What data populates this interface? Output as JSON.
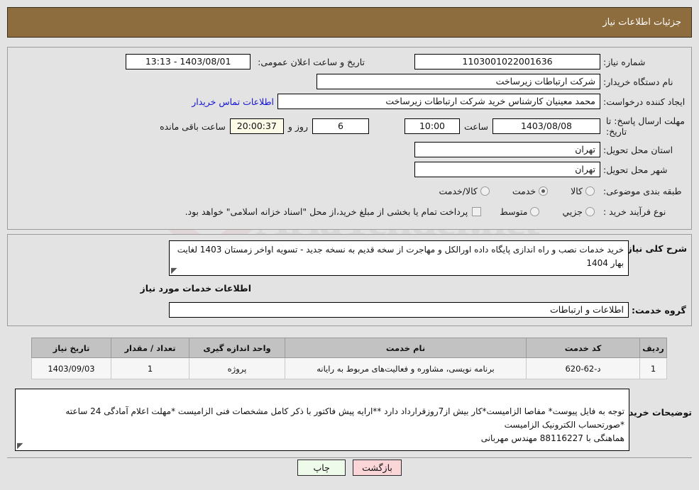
{
  "header": {
    "title": "جزئیات اطلاعات نیاز"
  },
  "watermark": {
    "text": "AriaTender.net"
  },
  "form": {
    "need_number_label": "شماره نیاز:",
    "need_number_value": "1103001022001636",
    "public_announce_label": "تاریخ و ساعت اعلان عمومی:",
    "public_announce_value": "1403/08/01 - 13:13",
    "buyer_org_label": "نام دستگاه خریدار:",
    "buyer_org_value": "شرکت ارتباطات زیرساخت",
    "requester_label": "ایجاد کننده درخواست:",
    "requester_value": "محمد معینیان کارشناس خرید شرکت ارتباطات زیرساخت",
    "buyer_contact_link": "اطلاعات تماس خریدار",
    "deadline_label": "مهلت ارسال پاسخ: تا تاریخ:",
    "deadline_date": "1403/08/08",
    "hour_label": "ساعت",
    "deadline_time": "10:00",
    "days_value": "6",
    "days_and_label": "روز و",
    "countdown_value": "20:00:37",
    "remaining_label": "ساعت باقی مانده",
    "province_label": "استان محل تحویل:",
    "province_value": "تهران",
    "city_label": "شهر محل تحویل:",
    "city_value": "تهران",
    "category_label": "طبقه بندی موضوعی:",
    "category_options": [
      {
        "label": "کالا",
        "checked": false
      },
      {
        "label": "خدمت",
        "checked": true
      },
      {
        "label": "کالا/خدمت",
        "checked": false
      }
    ],
    "process_label": "نوع فرآیند خرید :",
    "process_options": [
      {
        "label": "جزیي",
        "checked": false
      },
      {
        "label": "متوسط",
        "checked": false
      }
    ],
    "treasury_checkbox_checked": false,
    "treasury_note": "پرداخت تمام یا بخشی از مبلغ خرید،از محل \"اسناد خزانه اسلامی\" خواهد بود."
  },
  "description": {
    "label": "شرح کلی نیاز:",
    "value": "خرید خدمات نصب و راه اندازی پایگاه داده اورالکل و مهاجرت از سخه قدیم به نسخه جدید   -    تسویه اواخر زمستان 1403 لغایت بهار 1404"
  },
  "services_section": {
    "heading": "اطلاعات خدمات مورد نیاز",
    "group_label": "گروه خدمت:",
    "group_value": "اطلاعات و ارتباطات"
  },
  "table": {
    "columns": [
      "ردیف",
      "کد خدمت",
      "نام خدمت",
      "واحد اندازه گیری",
      "تعداد / مقدار",
      "تاریخ نیاز"
    ],
    "rows": [
      {
        "row_no": "1",
        "service_code": "د-62-620",
        "service_name": "برنامه نویسی، مشاوره و فعالیت‌های مربوط به رایانه",
        "unit": "پروژه",
        "quantity": "1",
        "need_date": "1403/09/03"
      }
    ]
  },
  "notes": {
    "label": "توضیحات خریدار:",
    "value": "توجه به فایل پیوست* مفاصا الزامیست*کار بیش از7روزقرارداد دارد **ارایه پیش فاکتور با ذکر کامل مشخصات فنی الزامیست *مهلت اعلام آمادگی 24 ساعته *صورتحساب الکترونیک الزامیست\nهماهنگی با 88116227 مهندس مهربانی"
  },
  "footer": {
    "print_label": "چاپ",
    "back_label": "بازگشت"
  },
  "colors": {
    "header_bar": "#8d6c3d",
    "page_background": "#e3e3e3",
    "link": "#1313d6",
    "timer_field": "#fbfbe8",
    "print_button": "#eefbea",
    "back_button": "#fbd6d8",
    "table_header": "#c2c2c2",
    "table_row": "#f6f6f6"
  }
}
